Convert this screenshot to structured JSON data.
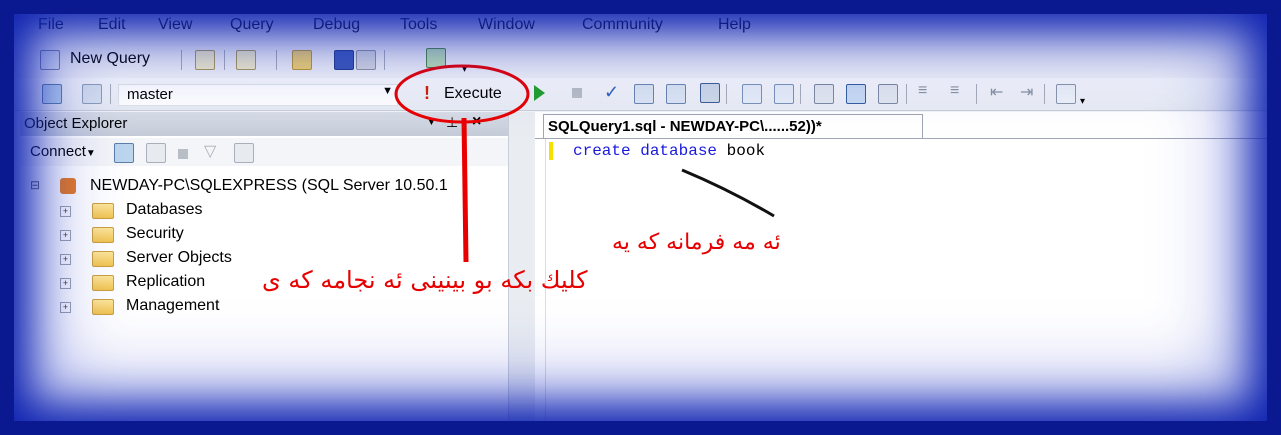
{
  "menu": [
    "File",
    "Edit",
    "View",
    "Query",
    "Debug",
    "Tools",
    "Window",
    "Community",
    "Help"
  ],
  "toolbar1": {
    "new_query": "New Query"
  },
  "toolbar2": {
    "database": "master",
    "execute": "Execute"
  },
  "object_explorer": {
    "title": "Object Explorer",
    "connect": "Connect",
    "server": "NEWDAY-PC\\SQLEXPRESS (SQL Server 10.50.1",
    "nodes": [
      "Databases",
      "Security",
      "Server Objects",
      "Replication",
      "Management"
    ]
  },
  "editor": {
    "tab_title": "SQLQuery1.sql - NEWDAY-PC\\......52))*",
    "code_kw1": "create",
    "code_kw2": "database",
    "code_ident": "book"
  },
  "annotations": {
    "line1": "ئه مه فرمانه كه يه",
    "line2": "كليك بكه بو بينينى ئه نجامه كه ى"
  },
  "colors": {
    "annotation": "#e80000",
    "keyword": "#1a1adf",
    "frame": "#0b1990"
  }
}
